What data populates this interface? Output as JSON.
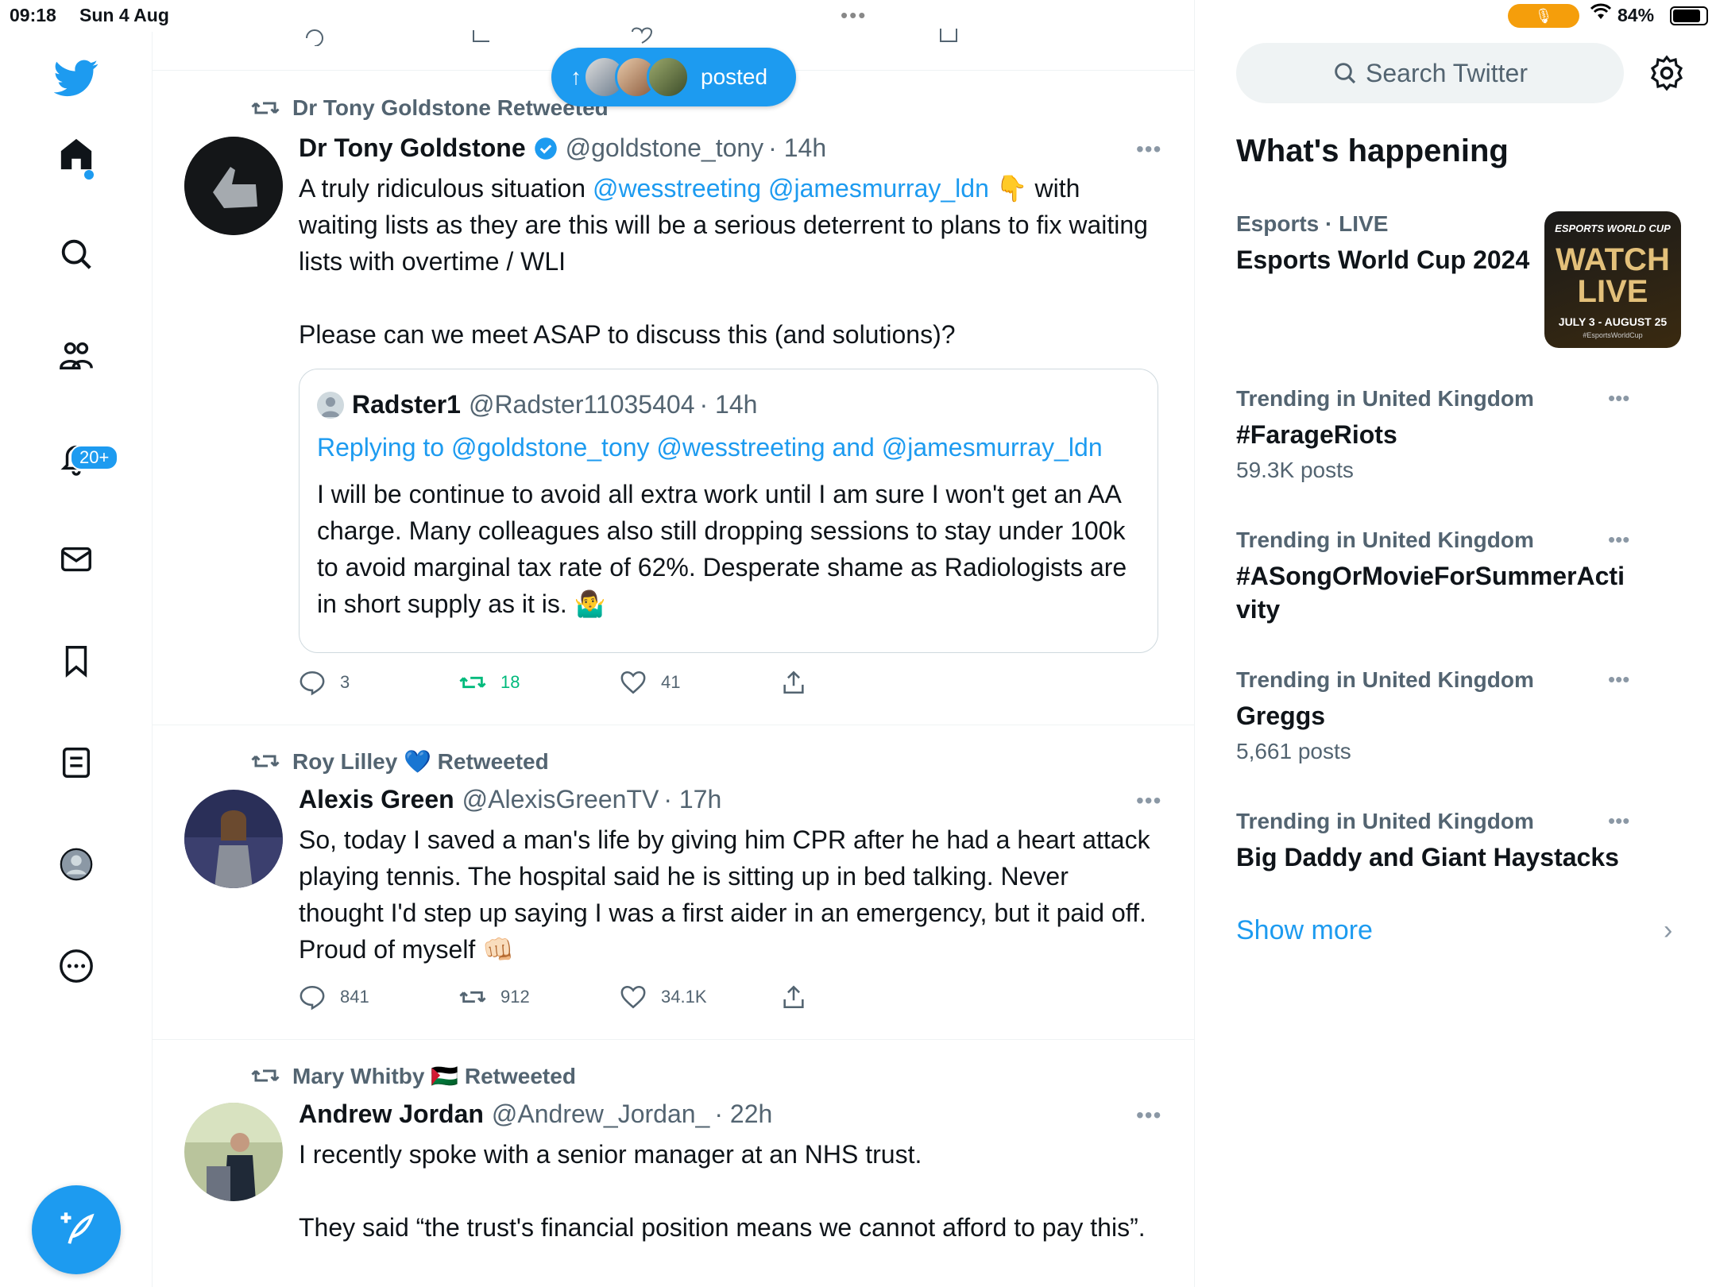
{
  "status_bar": {
    "time": "09:18",
    "date": "Sun 4 Aug",
    "battery": "84%",
    "battery_level": 0.84
  },
  "nav": {
    "notifications_badge": "20+"
  },
  "new_posts_pill": {
    "label": "posted"
  },
  "tweets": [
    {
      "retweeted_by": "Dr Tony Goldstone Retweeted",
      "name": "Dr Tony Goldstone",
      "handle": "@goldstone_tony",
      "time": "· 14h",
      "text_a": "A truly ridiculous situation ",
      "mention_a": "@wesstreeting @jamesmurray_ldn",
      "text_b": " 👇 with waiting lists as they are this will be a serious deterrent to plans to fix waiting lists with overtime / WLI\n\nPlease can we meet ASAP to discuss this (and solutions)?",
      "quote": {
        "name": "Radster1",
        "handle": "@Radster11035404",
        "time": "· 14h",
        "replying_to": "Replying to @goldstone_tony @wesstreeting and @jamesmurray_ldn",
        "text": "I will be continue to avoid all extra work until I am sure I won't get an AA charge. Many colleagues also still dropping sessions to stay under 100k to avoid marginal tax rate of 62%. Desperate shame as Radiologists are in short supply as it is. 🤷‍♂️"
      },
      "replies": "3",
      "retweets": "18",
      "likes": "41"
    },
    {
      "retweeted_by": "Roy Lilley 💙 Retweeted",
      "name": "Alexis Green",
      "handle": "@AlexisGreenTV",
      "time": "· 17h",
      "text": "So, today I saved a man's life by giving him CPR after he had a heart attack playing tennis. The hospital said he is sitting up in bed talking. Never thought I'd step up saying I was a first aider in an emergency, but it paid off. Proud of myself 👊🏻",
      "replies": "841",
      "retweets": "912",
      "likes": "34.1K"
    },
    {
      "retweeted_by": "Mary Whitby 🇵🇸 Retweeted",
      "name": "Andrew Jordan",
      "handle": "@Andrew_Jordan_",
      "time": "· 22h",
      "text": "I recently spoke with a senior manager at an NHS trust.\n\nThey said “the trust's financial position means we cannot afford to pay this”."
    }
  ],
  "sidebar": {
    "search_placeholder": "Search Twitter",
    "whats_happening": "What's happening",
    "esports": {
      "meta": "Esports · LIVE",
      "title": "Esports World Cup 2024",
      "img_line1": "ESPORTS WORLD CUP",
      "img_line2": "WATCH LIVE",
      "img_line3": "JULY 3 - AUGUST 25",
      "img_line4": "#EsportsWorldCup"
    },
    "trends": [
      {
        "meta": "Trending in United Kingdom",
        "title": "#FarageRiots",
        "count": "59.3K posts"
      },
      {
        "meta": "Trending in United Kingdom",
        "title": "#ASongOrMovieForSummerActi vity",
        "count": ""
      },
      {
        "meta": "Trending in United Kingdom",
        "title": "Greggs",
        "count": "5,661 posts"
      },
      {
        "meta": "Trending in United Kingdom",
        "title": "Big Daddy and Giant Haystacks",
        "count": ""
      }
    ],
    "show_more": "Show more"
  },
  "colors": {
    "accent": "#1d9bf0",
    "retweet_green": "#00ba7c",
    "muted": "#536471"
  }
}
